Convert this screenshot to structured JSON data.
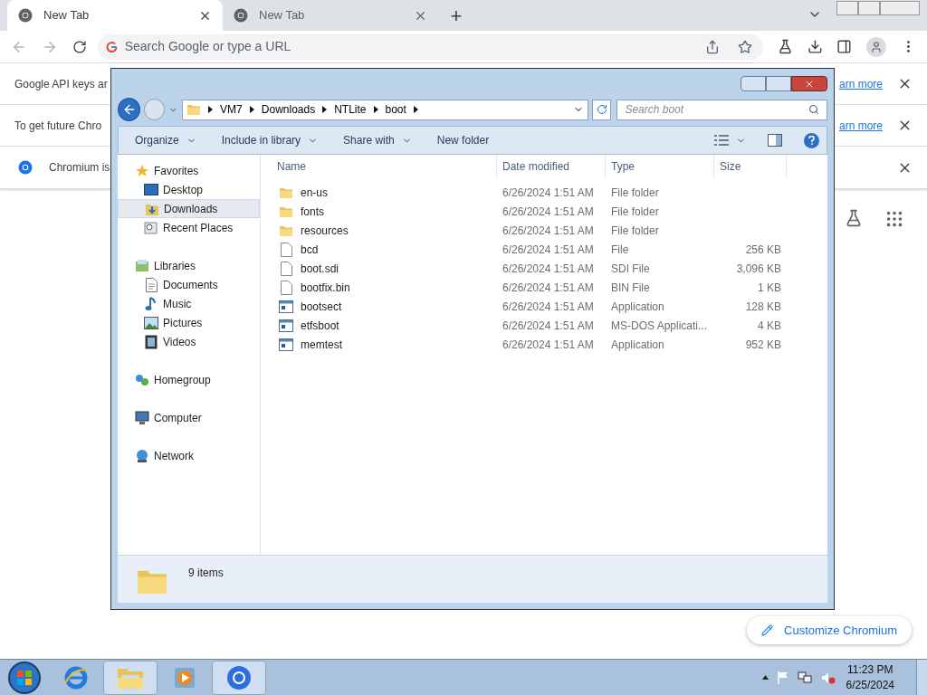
{
  "browser": {
    "tabs": [
      {
        "title": "New Tab",
        "selected": true
      },
      {
        "title": "New Tab",
        "selected": false
      }
    ],
    "new_tab": "+",
    "omnibox": {
      "placeholder": "Search Google or type a URL"
    },
    "infobars": [
      {
        "kind": "text",
        "text": "Google API keys ar",
        "link": "arn more"
      },
      {
        "kind": "text",
        "text": "To get future Chro",
        "link": "arn more"
      },
      {
        "kind": "chromium",
        "text": "Chromium is"
      }
    ],
    "customize_button": "Customize Chromium"
  },
  "explorer": {
    "path": [
      "VM7",
      "Downloads",
      "NTLite",
      "boot"
    ],
    "search": {
      "placeholder": "Search boot"
    },
    "toolbar": [
      {
        "label": "Organize",
        "dropdown": true
      },
      {
        "label": "Include in library",
        "dropdown": true
      },
      {
        "label": "Share with",
        "dropdown": true
      },
      {
        "label": "New folder",
        "dropdown": false
      }
    ],
    "nav": [
      {
        "label": "Favorites",
        "kind": "favorites",
        "items": [
          {
            "label": "Desktop",
            "kind": "desktop",
            "selected": false
          },
          {
            "label": "Downloads",
            "kind": "downloads",
            "selected": true
          },
          {
            "label": "Recent Places",
            "kind": "recent",
            "selected": false
          }
        ]
      },
      {
        "label": "Libraries",
        "kind": "libraries",
        "items": [
          {
            "label": "Documents",
            "kind": "documents",
            "selected": false
          },
          {
            "label": "Music",
            "kind": "music",
            "selected": false
          },
          {
            "label": "Pictures",
            "kind": "pictures",
            "selected": false
          },
          {
            "label": "Videos",
            "kind": "videos",
            "selected": false
          }
        ]
      },
      {
        "label": "Homegroup",
        "kind": "homegroup"
      },
      {
        "label": "Computer",
        "kind": "computer"
      },
      {
        "label": "Network",
        "kind": "network"
      }
    ],
    "columns": [
      "Name",
      "Date modified",
      "Type",
      "Size"
    ],
    "rows": [
      {
        "kind": "folder",
        "name": "en-us",
        "date": "6/26/2024 1:51 AM",
        "type": "File folder"
      },
      {
        "kind": "folder",
        "name": "fonts",
        "date": "6/26/2024 1:51 AM",
        "type": "File folder"
      },
      {
        "kind": "folder",
        "name": "resources",
        "date": "6/26/2024 1:51 AM",
        "type": "File folder"
      },
      {
        "kind": "file",
        "name": "bcd",
        "date": "6/26/2024 1:51 AM",
        "type": "File",
        "size": "256 KB"
      },
      {
        "kind": "file",
        "name": "boot.sdi",
        "date": "6/26/2024 1:51 AM",
        "type": "SDI File",
        "size": "3,096 KB"
      },
      {
        "kind": "file",
        "name": "bootfix.bin",
        "date": "6/26/2024 1:51 AM",
        "type": "BIN File",
        "size": "1 KB"
      },
      {
        "kind": "app",
        "name": "bootsect",
        "date": "6/26/2024 1:51 AM",
        "type": "Application",
        "size": "128 KB"
      },
      {
        "kind": "app",
        "name": "etfsboot",
        "date": "6/26/2024 1:51 AM",
        "type": "MS-DOS Applicati...",
        "size": "4 KB"
      },
      {
        "kind": "app",
        "name": "memtest",
        "date": "6/26/2024 1:51 AM",
        "type": "Application",
        "size": "952 KB"
      }
    ],
    "status": "9 items"
  },
  "taskbar": {
    "apps": [
      {
        "kind": "ie",
        "active": false
      },
      {
        "kind": "explorer",
        "active": true
      },
      {
        "kind": "media",
        "active": false
      },
      {
        "kind": "chrome",
        "active": true
      }
    ],
    "time": "11:23 PM",
    "date": "6/25/2024"
  }
}
